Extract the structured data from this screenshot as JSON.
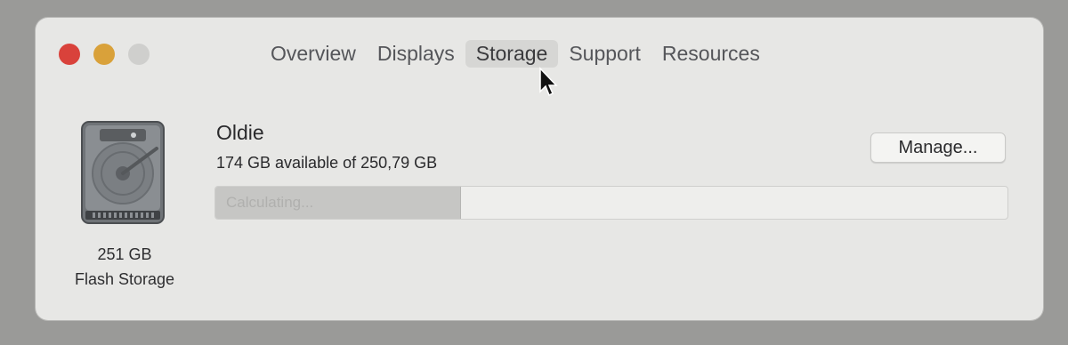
{
  "window": {
    "tabs": [
      {
        "label": "Overview"
      },
      {
        "label": "Displays"
      },
      {
        "label": "Storage",
        "active": true
      },
      {
        "label": "Support"
      },
      {
        "label": "Resources"
      }
    ]
  },
  "disk": {
    "capacity": "251 GB",
    "type": "Flash Storage",
    "icon": "hard-drive-icon"
  },
  "volume": {
    "name": "Oldie",
    "availability": "174 GB available of 250,79 GB",
    "used_fraction": 0.31,
    "bar_label": "Calculating..."
  },
  "actions": {
    "manage_label": "Manage..."
  },
  "colors": {
    "close": "#d9423b",
    "minimize": "#d9a13a",
    "zoom": "#cfcfcd"
  }
}
